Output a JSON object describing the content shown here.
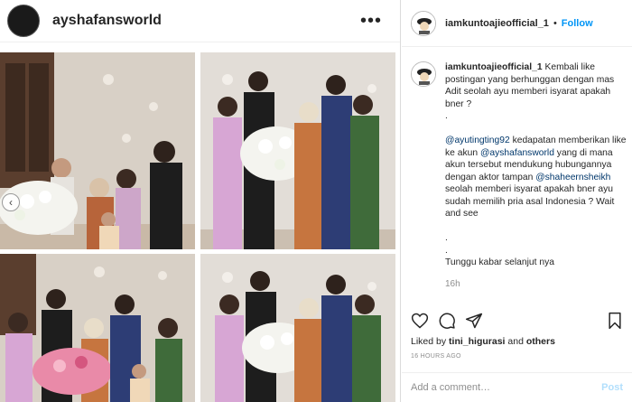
{
  "post": {
    "username": "ayshafansworld",
    "menu_icon": "more-dots-icon",
    "colors": {
      "avatar": "#1a1a1a",
      "photo_bg": "#cfc7bd"
    }
  },
  "side": {
    "username": "iamkuntoajieofficial_1",
    "bullet": "•",
    "follow_label": "Follow",
    "caption": {
      "username": "iamkuntoajieofficial_1",
      "line1": "Kembali like postingan yang berhunggan dengan mas Adit seolah ayu memberi isyarat apakah bner ?",
      "dot1": ".",
      "mention1": "@ayutingting92",
      "text2": " kedapatan memberikan like ke akun ",
      "mention2": "@ayshafansworld",
      "text3": " yang di mana akun tersebut mendukung hubungannya dengan aktor tampan ",
      "mention3": "@shaheernsheikh",
      "text4": " seolah memberi isyarat apakah bner ayu sudah memilih pria asal Indonesia ? Wait and see",
      "dot2": ".",
      "dot3": ".",
      "closing": "Tunggu kabar selanjut nya",
      "time": "16h"
    },
    "actions": {
      "like_icon": "heart-icon",
      "comment_icon": "comment-icon",
      "share_icon": "share-icon",
      "save_icon": "bookmark-icon"
    },
    "liked_prefix": "Liked by ",
    "liked_user": "tini_higurasi",
    "liked_mid": " and ",
    "liked_others": "others",
    "timestamp": "16 HOURS AGO",
    "comment_placeholder": "Add a comment…",
    "post_label": "Post",
    "colors": {
      "link": "#0095f6",
      "mention": "#00376b",
      "muted": "#8e8e8e"
    }
  }
}
